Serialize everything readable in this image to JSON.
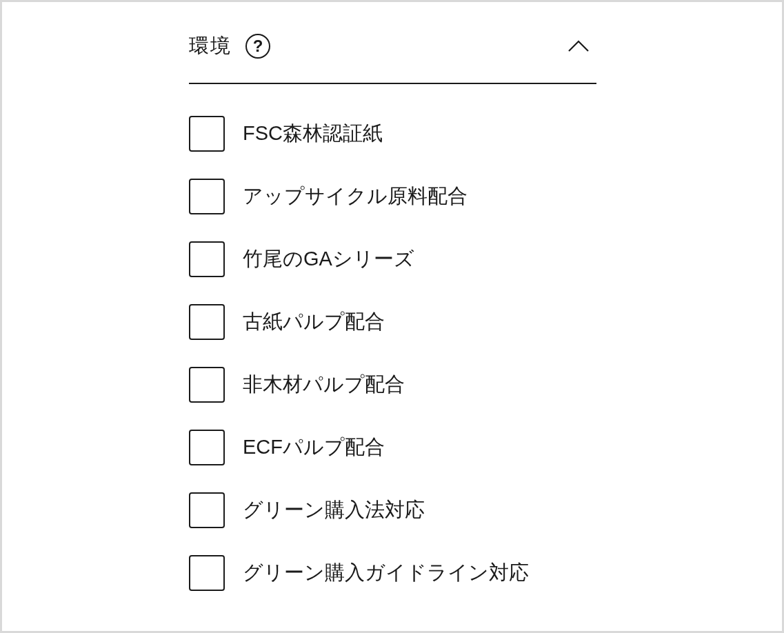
{
  "section": {
    "title": "環境",
    "help": "?",
    "expanded": true
  },
  "options": [
    {
      "label": "FSC森林認証紙",
      "checked": false
    },
    {
      "label": "アップサイクル原料配合",
      "checked": false
    },
    {
      "label": "竹尾のGAシリーズ",
      "checked": false
    },
    {
      "label": "古紙パルプ配合",
      "checked": false
    },
    {
      "label": "非木材パルプ配合",
      "checked": false
    },
    {
      "label": "ECFパルプ配合",
      "checked": false
    },
    {
      "label": "グリーン購入法対応",
      "checked": false
    },
    {
      "label": "グリーン購入ガイドライン対応",
      "checked": false
    }
  ]
}
